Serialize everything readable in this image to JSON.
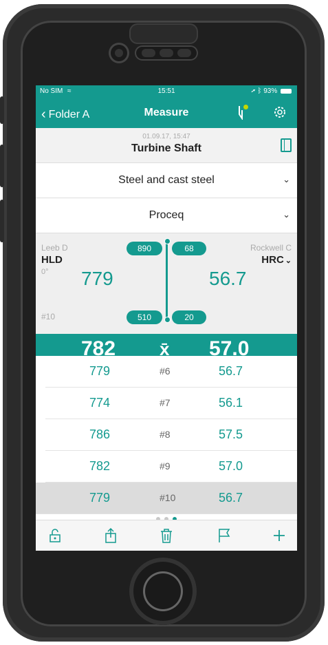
{
  "status": {
    "carrier": "No SIM",
    "time": "15:51",
    "battery": "93%"
  },
  "nav": {
    "back_label": "Folder A",
    "title": "Measure"
  },
  "header": {
    "date": "01.09.17, 15:47",
    "name": "Turbine Shaft"
  },
  "material": {
    "label": "Steel and cast steel"
  },
  "standard": {
    "label": "Proceq"
  },
  "scales": {
    "left_type": "Leeb D",
    "left_unit": "HLD",
    "angle": "0°",
    "right_type": "Rockwell C",
    "right_unit": "HRC",
    "left_value": "779",
    "right_value": "56.7",
    "count": "#10",
    "left_max": "890",
    "left_min": "510",
    "right_max": "68",
    "right_min": "20"
  },
  "average": {
    "left": "782",
    "symbol": "x̄",
    "right": "57.0"
  },
  "measurements": [
    {
      "v1": "779",
      "idx": "#6",
      "v2": "56.7"
    },
    {
      "v1": "774",
      "idx": "#7",
      "v2": "56.1"
    },
    {
      "v1": "786",
      "idx": "#8",
      "v2": "57.5"
    },
    {
      "v1": "782",
      "idx": "#9",
      "v2": "57.0"
    },
    {
      "v1": "779",
      "idx": "#10",
      "v2": "56.7"
    }
  ],
  "pager": {
    "active": 3,
    "total": 3
  },
  "toolbar": [
    "lock-icon",
    "share-icon",
    "trash-icon",
    "flag-icon",
    "plus-icon"
  ]
}
